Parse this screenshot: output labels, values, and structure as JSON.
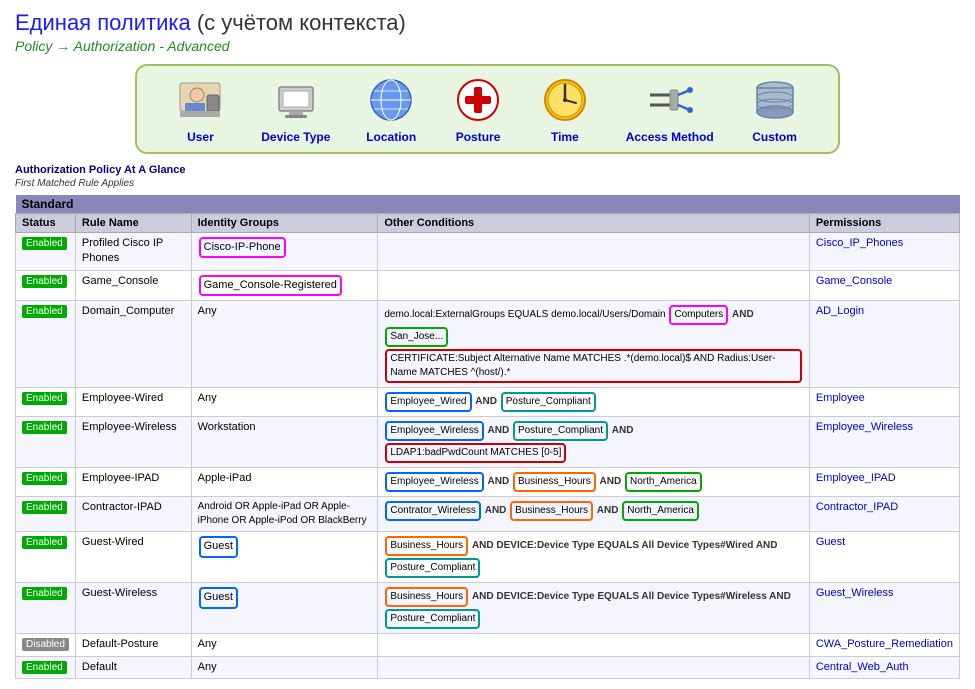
{
  "title": {
    "russian": "Единая политика",
    "subtitle_paren": " (с учётом контекста)",
    "policy_path": "Policy → Authorization - Advanced"
  },
  "icons": [
    {
      "id": "user",
      "label": "User",
      "emoji": "👤",
      "color": "#0000cc"
    },
    {
      "id": "device_type",
      "label": "Device Type",
      "emoji": "🖨️",
      "color": "#0000cc"
    },
    {
      "id": "location",
      "label": "Location",
      "emoji": "🌐",
      "color": "#0000cc"
    },
    {
      "id": "posture",
      "label": "Posture",
      "emoji": "⚕️",
      "color": "#0000cc"
    },
    {
      "id": "time",
      "label": "Time",
      "emoji": "🕐",
      "color": "#0000cc"
    },
    {
      "id": "access_method",
      "label": "Access Method",
      "emoji": "🔌",
      "color": "#0000cc"
    },
    {
      "id": "custom",
      "label": "Custom",
      "emoji": "🗄️",
      "color": "#0000cc"
    }
  ],
  "policy_summary": "Authorization Policy At A Glance",
  "first_matched": "First Matched Rule Applies",
  "section": "Standard",
  "columns": [
    "Status",
    "Rule Name",
    "Identity Groups",
    "Other Conditions",
    "",
    "Permissions"
  ],
  "rows": [
    {
      "status": "Enabled",
      "rule_name": "Profiled Cisco IP Phones",
      "identity": "Cisco-IP-Phone",
      "conditions": "",
      "permissions": "Cisco_IP_Phones"
    },
    {
      "status": "Enabled",
      "rule_name": "Game_Console",
      "identity": "Game_Console-Registered",
      "conditions": "",
      "permissions": "Game_Console"
    },
    {
      "status": "Enabled",
      "rule_name": "Domain_Computer",
      "identity": "Any",
      "conditions": "demo.local:ExternalGroups EQUALS demo.local/Users/Domain Computers AND San_Jose... CERTIFICATE:Subject Alternative Name MATCHES .*(demo.local)$ AND Radius:User-Name MATCHES ^(host/).*",
      "permissions": "AD_Login"
    },
    {
      "status": "Enabled",
      "rule_name": "Employee-Wired",
      "identity": "Any",
      "conditions": "Employee_Wired AND Posture_Compliant",
      "permissions": "Employee"
    },
    {
      "status": "Enabled",
      "rule_name": "Employee-Wireless",
      "identity": "Workstation",
      "conditions": "Employee_Wireless AND Posture_Compliant AND LDAP1:badPwdCount MATCHES [0-5]",
      "permissions": "Employee_Wireless"
    },
    {
      "status": "Enabled",
      "rule_name": "Employee-IPAD",
      "identity": "Apple-iPad",
      "conditions": "Employee_Wireless AND Business_Hours AND North_America",
      "permissions": "Employee_IPAD"
    },
    {
      "status": "Enabled",
      "rule_name": "Contractor-IPAD",
      "identity": "Android OR Apple-iPad OR Apple-iPhone OR Apple-iPod OR BlackBerry",
      "conditions": "Contrator_Wireless AND Business_Hours AND North_America",
      "permissions": "Contractor_IPAD"
    },
    {
      "status": "Enabled",
      "rule_name": "Guest-Wired",
      "identity": "Guest",
      "conditions": "Business_Hours AND DEVICE:Device Type EQUALS All Device Types#Wired AND Posture_Compliant",
      "permissions": "Guest"
    },
    {
      "status": "Enabled",
      "rule_name": "Guest-Wireless",
      "identity": "Guest",
      "conditions": "Business_Hours AND DEVICE:Device Type EQUALS All Device Types#Wireless AND Posture_Compliant",
      "permissions": "Guest_Wireless"
    },
    {
      "status": "Disabled",
      "rule_name": "Default-Posture",
      "identity": "Any",
      "conditions": "",
      "permissions": "CWA_Posture_Remediation"
    },
    {
      "status": "Enabled",
      "rule_name": "Default",
      "identity": "Any",
      "conditions": "",
      "permissions": "Central_Web_Auth"
    }
  ]
}
